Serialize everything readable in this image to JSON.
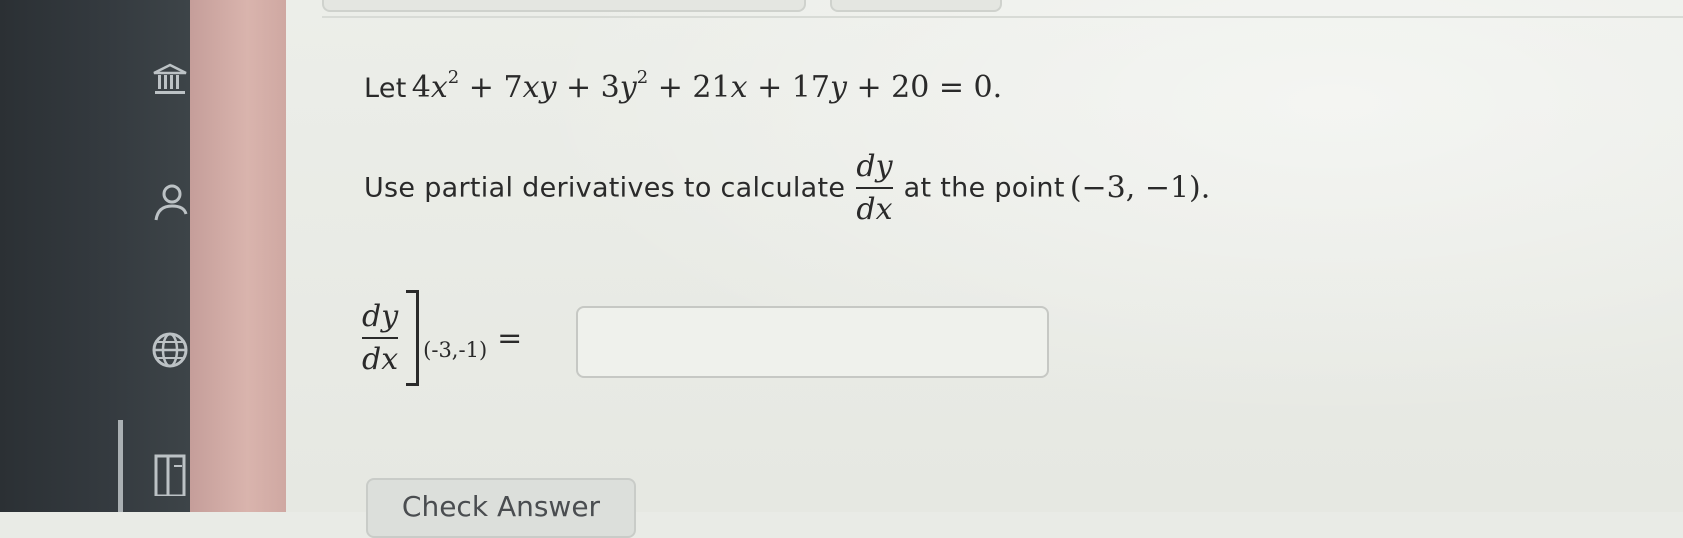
{
  "sidebar": {
    "icons": [
      "bank-icon",
      "person-icon",
      "globe-icon",
      "book-icon"
    ]
  },
  "problem": {
    "let_word": "Let",
    "equation": {
      "t1_coef": "4",
      "t1_var": "x",
      "t1_exp": "2",
      "op1": "+",
      "t2_coef": "7",
      "t2_var": "xy",
      "op2": "+",
      "t3_coef": "3",
      "t3_var": "y",
      "t3_exp": "2",
      "op3": "+",
      "t4_coef": "21",
      "t4_var": "x",
      "op4": "+",
      "t5_coef": "17",
      "t5_var": "y",
      "op5": "+",
      "t6": "20",
      "equals": "=",
      "rhs": "0."
    },
    "instruction_before": "Use partial derivatives to calculate",
    "frac_num": "dy",
    "frac_den": "dx",
    "instruction_after": "at the point",
    "point": "(−3, −1)."
  },
  "answer": {
    "frac_num": "dy",
    "frac_den": "dx",
    "eval_point": "(-3,-1)",
    "equals": "=",
    "input_value": ""
  },
  "check_answer_label": "Check Answer"
}
